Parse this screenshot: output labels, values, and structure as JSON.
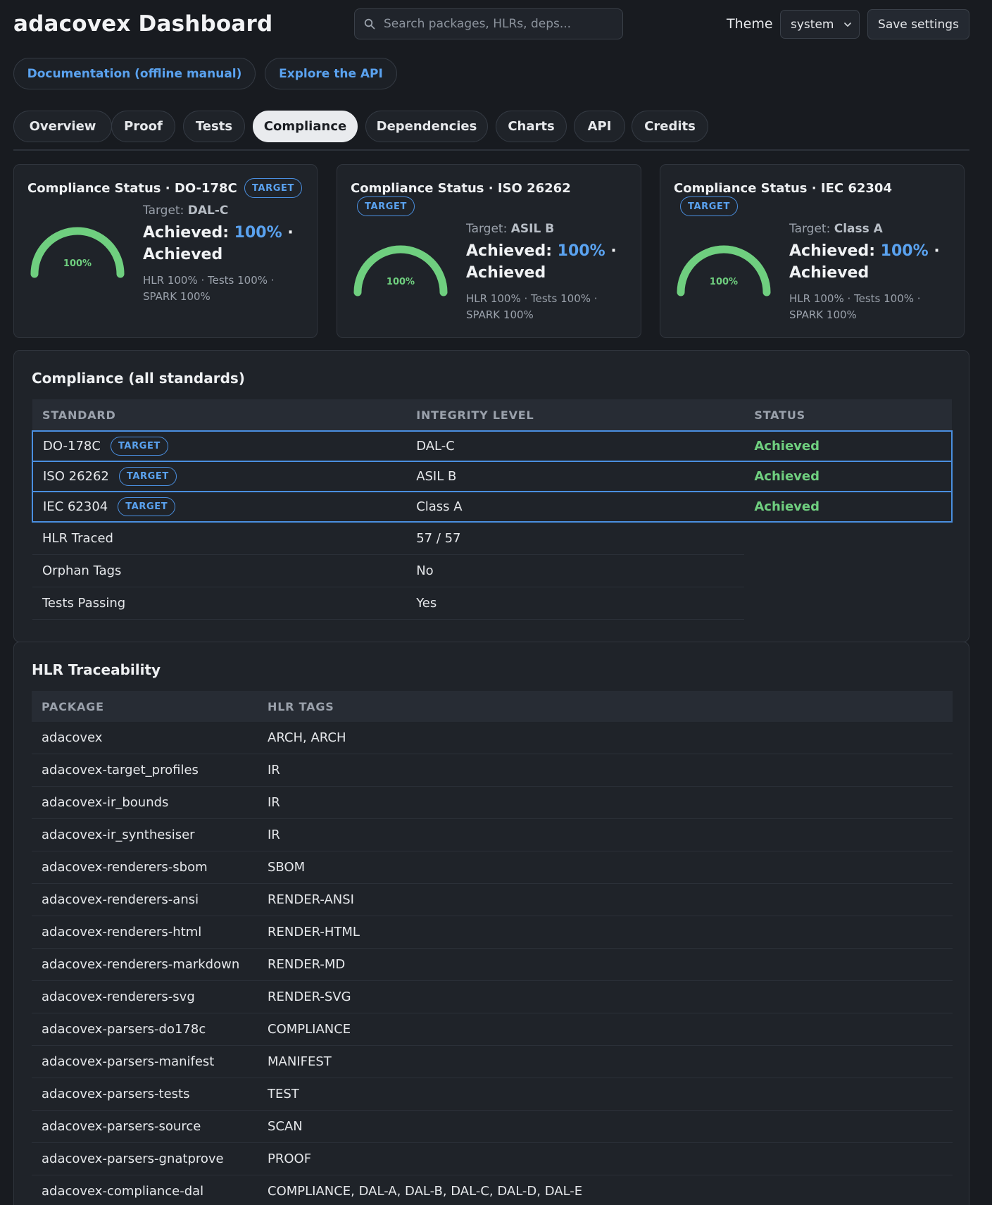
{
  "header": {
    "title": "adacovex Dashboard",
    "search_placeholder": "Search packages, HLRs, deps...",
    "theme_label": "Theme",
    "theme_value": "system",
    "save_label": "Save settings"
  },
  "links": {
    "docs": "Documentation (offline manual)",
    "api": "Explore the API"
  },
  "tabs": [
    {
      "label": "Overview"
    },
    {
      "label": "Proof"
    },
    {
      "label": "Tests"
    },
    {
      "label": "Compliance",
      "active": true
    },
    {
      "label": "Dependencies"
    },
    {
      "label": "Charts"
    },
    {
      "label": "API"
    },
    {
      "label": "Credits"
    }
  ],
  "cards": [
    {
      "title": "Compliance Status · DO-178C",
      "badge": "TARGET",
      "target_label": "Target:",
      "target_value": "DAL-C",
      "achieved_label": "Achieved:",
      "achieved_pct": "100%",
      "achieved_suffix": "· Achieved",
      "metrics": "HLR 100% · Tests 100% · SPARK 100%",
      "gauge_label": "100%",
      "gauge_value": 1.0
    },
    {
      "title": "Compliance Status · ISO 26262",
      "badge": "TARGET",
      "target_label": "Target:",
      "target_value": "ASIL B",
      "achieved_label": "Achieved:",
      "achieved_pct": "100%",
      "achieved_suffix": "· Achieved",
      "metrics": "HLR 100% · Tests 100% · SPARK 100%",
      "gauge_label": "100%",
      "gauge_value": 1.0
    },
    {
      "title": "Compliance Status · IEC 62304",
      "badge": "TARGET",
      "target_label": "Target:",
      "target_value": "Class A",
      "achieved_label": "Achieved:",
      "achieved_pct": "100%",
      "achieved_suffix": "· Achieved",
      "metrics": "HLR 100% · Tests 100% · SPARK 100%",
      "gauge_label": "100%",
      "gauge_value": 1.0
    }
  ],
  "compliance": {
    "title": "Compliance (all standards)",
    "headers": [
      "STANDARD",
      "INTEGRITY LEVEL",
      "STATUS"
    ],
    "rows": [
      {
        "standard": "DO-178C",
        "badge": "TARGET",
        "level": "DAL-C",
        "status": "Achieved"
      },
      {
        "standard": "ISO 26262",
        "badge": "TARGET",
        "level": "ASIL B",
        "status": "Achieved"
      },
      {
        "standard": "IEC 62304",
        "badge": "TARGET",
        "level": "Class A",
        "status": "Achieved"
      }
    ],
    "facts": [
      {
        "label": "HLR Traced",
        "value": "57 / 57"
      },
      {
        "label": "Orphan Tags",
        "value": "No"
      },
      {
        "label": "Tests Passing",
        "value": "Yes"
      }
    ]
  },
  "hlr": {
    "title": "HLR Traceability",
    "headers": [
      "PACKAGE",
      "HLR TAGS"
    ],
    "rows": [
      {
        "package": "adacovex",
        "tags": "ARCH, ARCH"
      },
      {
        "package": "adacovex-target_profiles",
        "tags": "IR"
      },
      {
        "package": "adacovex-ir_bounds",
        "tags": "IR"
      },
      {
        "package": "adacovex-ir_synthesiser",
        "tags": "IR"
      },
      {
        "package": "adacovex-renderers-sbom",
        "tags": "SBOM"
      },
      {
        "package": "adacovex-renderers-ansi",
        "tags": "RENDER-ANSI"
      },
      {
        "package": "adacovex-renderers-html",
        "tags": "RENDER-HTML"
      },
      {
        "package": "adacovex-renderers-markdown",
        "tags": "RENDER-MD"
      },
      {
        "package": "adacovex-renderers-svg",
        "tags": "RENDER-SVG"
      },
      {
        "package": "adacovex-parsers-do178c",
        "tags": "COMPLIANCE"
      },
      {
        "package": "adacovex-parsers-manifest",
        "tags": "MANIFEST"
      },
      {
        "package": "adacovex-parsers-tests",
        "tags": "TEST"
      },
      {
        "package": "adacovex-parsers-source",
        "tags": "SCAN"
      },
      {
        "package": "adacovex-parsers-gnatprove",
        "tags": "PROOF"
      },
      {
        "package": "adacovex-compliance-dal",
        "tags": "COMPLIANCE, DAL-A, DAL-B, DAL-C, DAL-D, DAL-E"
      }
    ]
  },
  "colors": {
    "background": "#181b20",
    "panel": "#1f2329",
    "accent": "#5aa2ef",
    "success": "#6fcf7f"
  },
  "icons": {
    "search": "search-icon",
    "select": "chevron-down-icon"
  }
}
